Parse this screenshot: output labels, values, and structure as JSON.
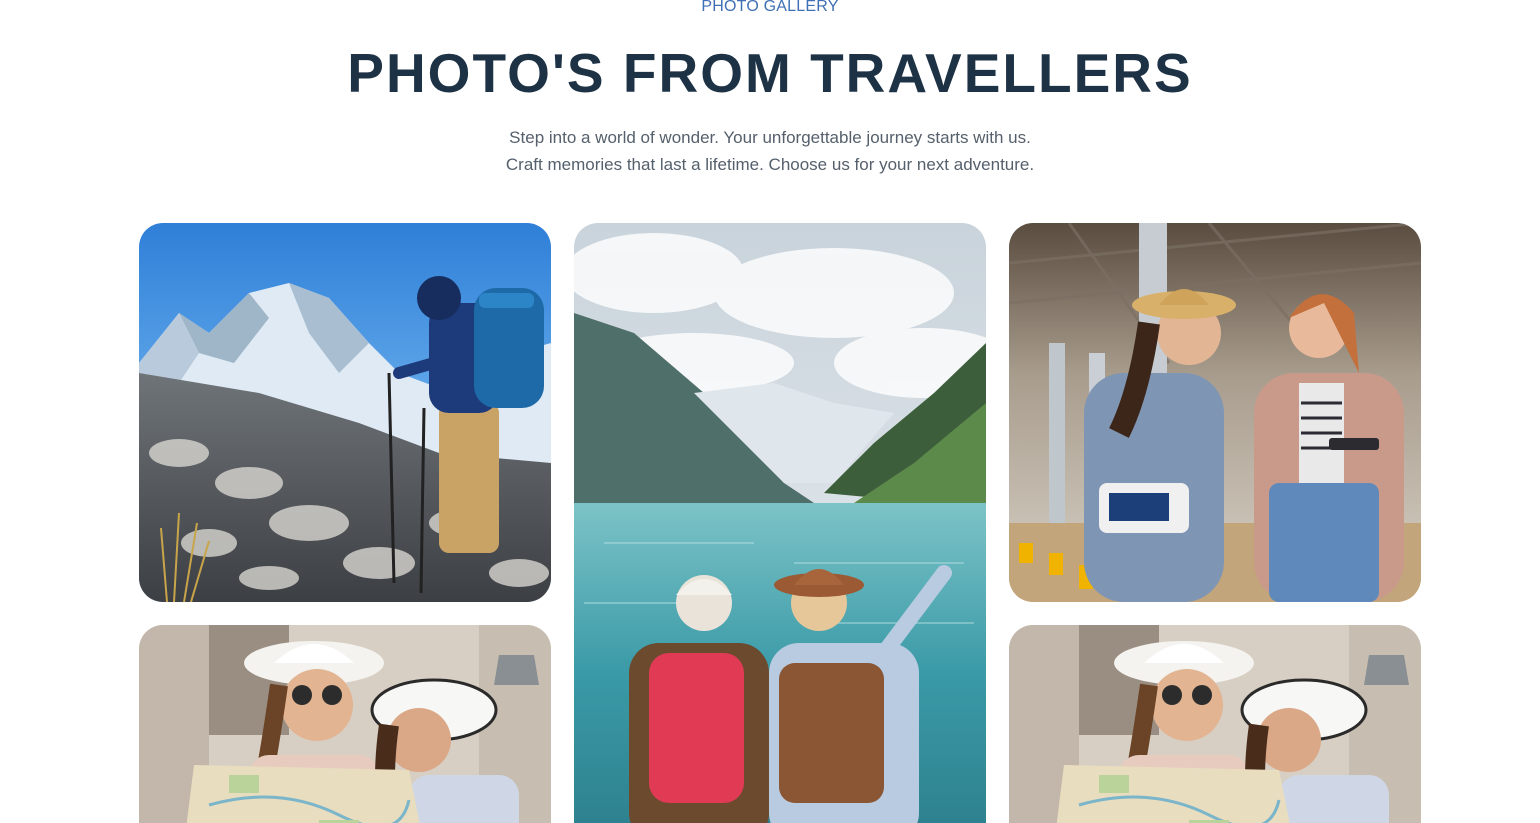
{
  "section": {
    "eyebrow": "PHOTO GALLERY",
    "title": "PHOTO'S FROM TRAVELLERS",
    "subtitle_lines": [
      "Step into a world of wonder. Your unforgettable journey starts with us.",
      "Craft memories that last a lifetime. Choose us for your next adventure."
    ]
  },
  "gallery": {
    "photos": [
      {
        "subject": "hiker-snowy-mountains"
      },
      {
        "subject": "couple-at-mountain-lake"
      },
      {
        "subject": "two-women-at-airport"
      },
      {
        "subject": "two-women-reading-map"
      },
      {
        "subject": "two-women-reading-map"
      }
    ]
  },
  "colors": {
    "eyebrow": "#3f6fb4",
    "title": "#1e3246",
    "subtitle": "#55606c",
    "background": "#ffffff"
  }
}
